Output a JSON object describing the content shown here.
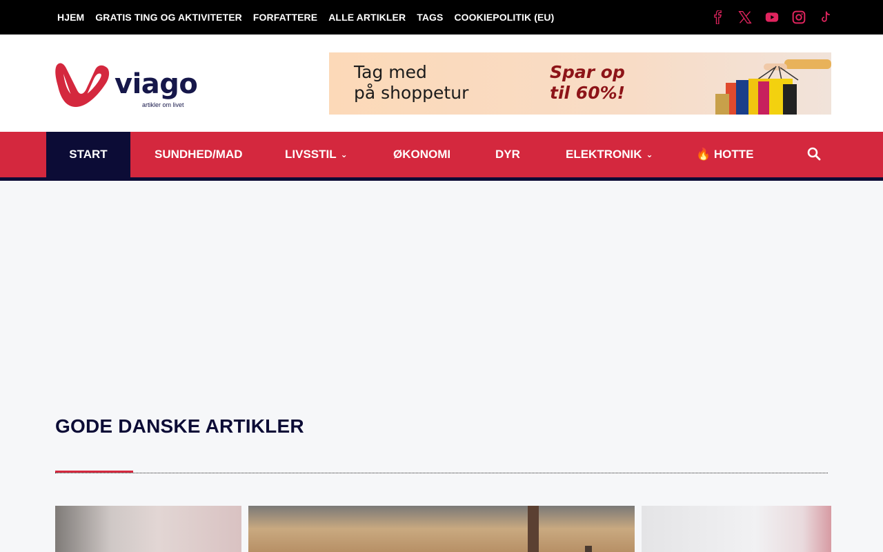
{
  "topbar": {
    "links": [
      "HJEM",
      "GRATIS TING OG AKTIVITETER",
      "FORFATTERE",
      "ALLE ARTIKLER",
      "TAGS",
      "COOKIEPOLITIK (EU)"
    ],
    "social_icons": [
      "facebook-icon",
      "x-icon",
      "youtube-icon",
      "instagram-icon",
      "tiktok-icon"
    ]
  },
  "logo": {
    "word": "viago",
    "tagline": "artikler om livet"
  },
  "banner": {
    "left_line1": "Tag med",
    "left_line2": "på shoppetur",
    "right_line1": "Spar op",
    "right_line2": "til 60%!"
  },
  "nav": {
    "items": [
      "START",
      "SUNDHED/MAD",
      "LIVSSTIL",
      "ØKONOMI",
      "DYR",
      "ELEKTRONIK",
      "🔥 HOTTE"
    ],
    "active": "START",
    "dropdown_items": [
      "LIVSSTIL",
      "ELEKTRONIK"
    ],
    "search_icon": "search-icon"
  },
  "section": {
    "title": "GODE DANSKE ARTIKLER"
  },
  "colors": {
    "brand_red": "#d4283e",
    "navy": "#0c0c36",
    "topbar_bg": "#000000",
    "social_icon": "#e0245e"
  }
}
